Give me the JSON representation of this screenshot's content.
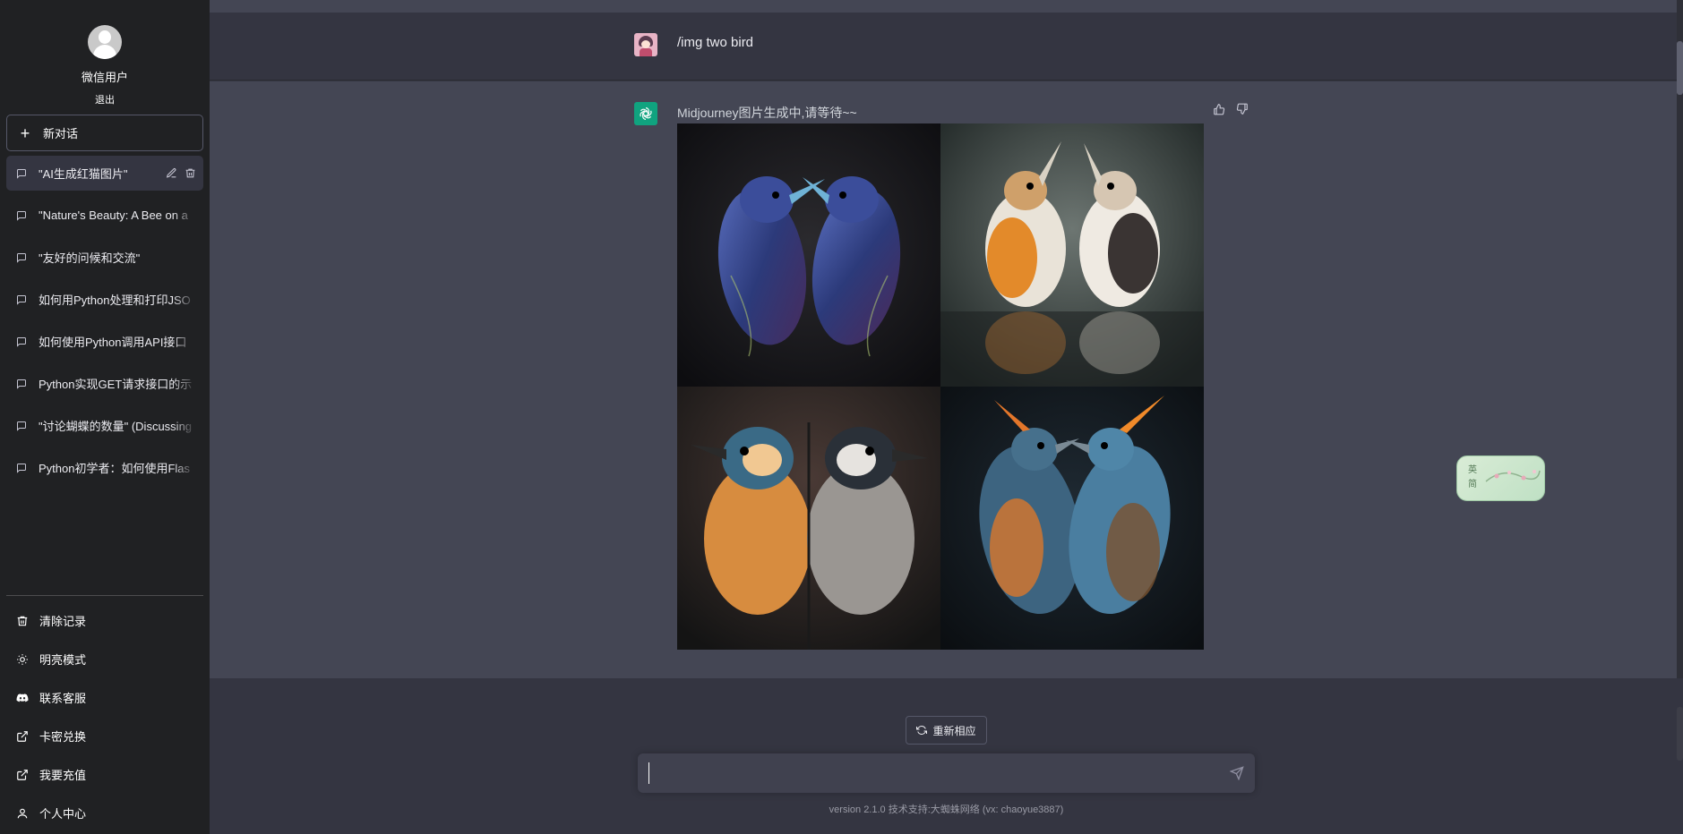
{
  "sidebar": {
    "username": "微信用户",
    "logout": "退出",
    "new_chat_label": "新对话",
    "conversations": [
      {
        "title": "\"AI生成红猫图片\"",
        "active": true
      },
      {
        "title": "\"Nature's Beauty: A Bee on a"
      },
      {
        "title": "\"友好的问候和交流\""
      },
      {
        "title": "如何用Python处理和打印JSO"
      },
      {
        "title": "如何使用Python调用API接口"
      },
      {
        "title": "Python实现GET请求接口的示"
      },
      {
        "title": "\"讨论蝴蝶的数量\" (Discussing"
      },
      {
        "title": "Python初学者：如何使用Flas"
      }
    ],
    "menu": [
      {
        "label": "清除记录",
        "icon": "trash-icon"
      },
      {
        "label": "明亮模式",
        "icon": "sun-icon"
      },
      {
        "label": "联系客服",
        "icon": "discord-icon"
      },
      {
        "label": "卡密兑换",
        "icon": "external-link-icon"
      },
      {
        "label": "我要充值",
        "icon": "external-link-icon"
      },
      {
        "label": "个人中心",
        "icon": "user-icon"
      }
    ]
  },
  "chat": {
    "user_message": "/img two bird",
    "bot_message": "Midjourney图片生成中,请等待~~",
    "regenerate_label": "重新相应",
    "input_placeholder": "",
    "input_value": ""
  },
  "footer": {
    "version": "version 2.1.0 技术支持:大蜘蛛网络 (vx: chaoyue3887)"
  },
  "ime": {
    "chars": [
      "英",
      "简"
    ]
  },
  "colors": {
    "sidebar_bg": "#202123",
    "main_bg": "#343541",
    "bot_row_bg": "#444654",
    "accent": "#10a37f"
  }
}
